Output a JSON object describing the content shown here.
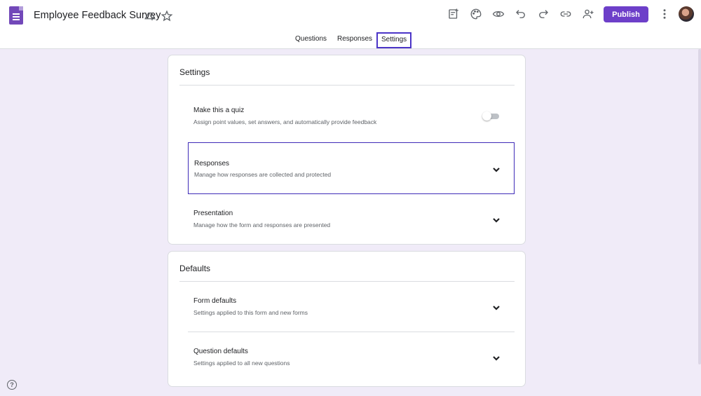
{
  "app": {
    "form_title": "Employee Feedback Survey"
  },
  "toolbar": {
    "icons": [
      "drive-add-icon",
      "star-icon",
      "add-ons-icon",
      "palette-icon",
      "preview-icon",
      "undo-icon",
      "redo-icon",
      "link-icon",
      "add-collaborators-icon",
      "more-vert-icon"
    ],
    "publish_label": "Publish"
  },
  "tabs": [
    {
      "label": "Questions",
      "active": false
    },
    {
      "label": "Responses",
      "active": false
    },
    {
      "label": "Settings",
      "active": true
    }
  ],
  "settings_card": {
    "heading": "Settings",
    "quiz": {
      "title": "Make this a quiz",
      "description": "Assign point values, set answers, and automatically provide feedback",
      "enabled": false
    },
    "responses": {
      "title": "Responses",
      "description": "Manage how responses are collected and protected"
    },
    "presentation": {
      "title": "Presentation",
      "description": "Manage how the form and responses are presented"
    }
  },
  "defaults_card": {
    "heading": "Defaults",
    "form_defaults": {
      "title": "Form defaults",
      "description": "Settings applied to this form and new forms"
    },
    "question_defaults": {
      "title": "Question defaults",
      "description": "Settings applied to all new questions"
    }
  },
  "help": {
    "glyph": "?"
  },
  "colors": {
    "accent": "#6d3fc9",
    "background": "#f0ebf8",
    "focus_outline": "#3f2bb8"
  }
}
